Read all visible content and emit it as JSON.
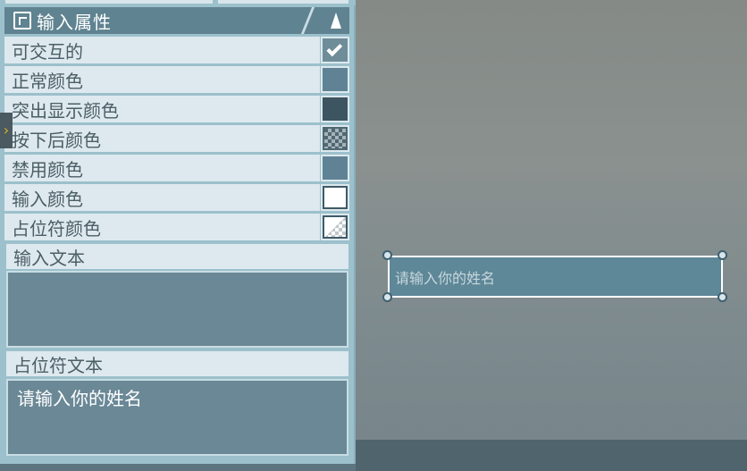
{
  "panel": {
    "header_title": "输入属性",
    "properties": [
      {
        "label": "可交互的",
        "swatch": "checkbox",
        "checked": true,
        "color": "#6f8d99"
      },
      {
        "label": "正常颜色",
        "swatch": "color",
        "color": "#5f8394"
      },
      {
        "label": "突出显示颜色",
        "swatch": "color",
        "color": "#3c5560"
      },
      {
        "label": "按下后颜色",
        "swatch": "checker",
        "color": "#4f6974"
      },
      {
        "label": "禁用颜色",
        "swatch": "color",
        "color": "#5f8394"
      },
      {
        "label": "输入颜色",
        "swatch": "color",
        "color": "#ffffff"
      },
      {
        "label": "占位符颜色",
        "swatch": "half-checker",
        "color": "#ffffff"
      }
    ],
    "input_text_label": "输入文本",
    "input_text_value": "",
    "placeholder_text_label": "占位符文本",
    "placeholder_text_value": "请输入你的姓名"
  },
  "scene": {
    "input_placeholder": "请输入你的姓名"
  },
  "colors": {
    "panel_bg": "#9cc0cc",
    "header_bg": "#5f8390",
    "row_bg": "#dde9ee",
    "textarea_bg": "#6a8896",
    "scene_input_bg": "#5e8797",
    "accent_arrow": "#e0b02a"
  }
}
